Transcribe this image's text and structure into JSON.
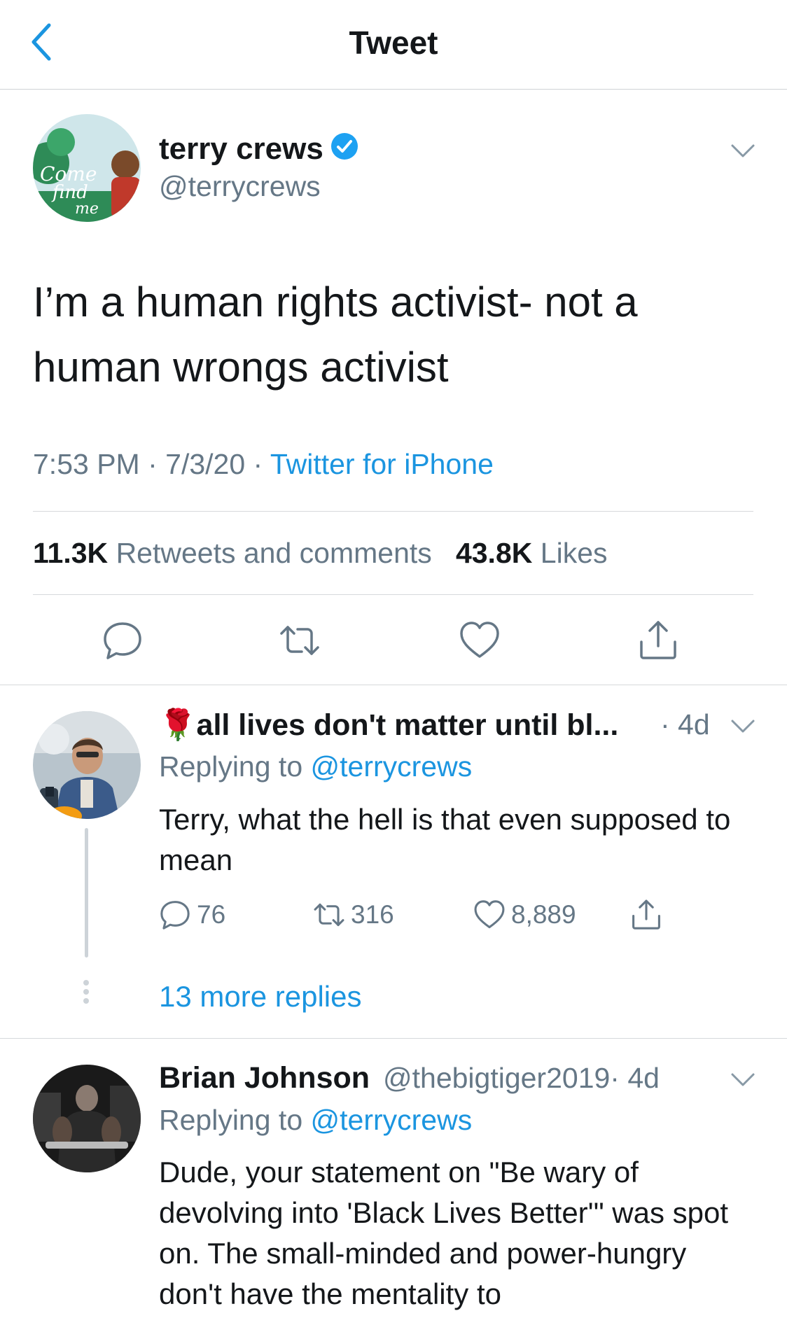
{
  "header": {
    "title": "Tweet",
    "back_icon": "chevron-left-icon"
  },
  "main_tweet": {
    "author_name": "terry crews",
    "verified": true,
    "handle": "@terrycrews",
    "avatar_lettering": [
      "Come",
      "find",
      "me"
    ],
    "text": "I’m a human rights activist- not a human wrongs activist",
    "time": "7:53 PM",
    "date": "7/3/20",
    "source": "Twitter for iPhone",
    "retweets_count": "11.3K",
    "retweets_label": "Retweets and comments",
    "likes_count": "43.8K",
    "likes_label": "Likes",
    "actions": [
      "reply-icon",
      "retweet-icon",
      "like-icon",
      "share-icon"
    ]
  },
  "replies": [
    {
      "emoji": "🌹",
      "name": "all lives don't matter until bl...",
      "time": "· 4d",
      "replying_prefix": "Replying to",
      "replying_to": "@terrycrews",
      "text": "Terry, what the hell is that even supposed to mean",
      "reply_count": "76",
      "retweet_count": "316",
      "like_count": "8,889",
      "more_replies": "13 more replies"
    },
    {
      "name": "Brian Johnson",
      "handle": "@thebigtiger2019",
      "time": "· 4d",
      "replying_prefix": "Replying to",
      "replying_to": "@terrycrews",
      "text": "Dude, your statement on \"Be wary of devolving into 'Black Lives Better'\" was spot on.  The small-minded and power-hungry don't have the mentality to"
    }
  ],
  "colors": {
    "accent": "#1b95e0",
    "secondary_text": "#657786",
    "divider": "#d6d9db"
  }
}
